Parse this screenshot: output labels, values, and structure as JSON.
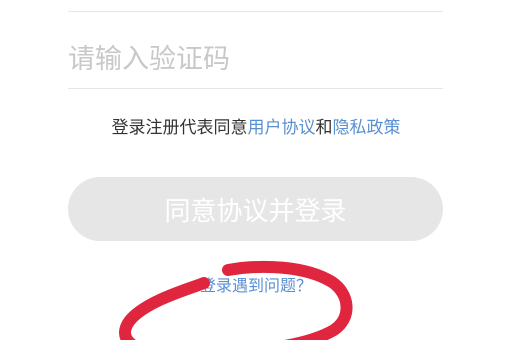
{
  "code_field": {
    "placeholder": "请输入验证码",
    "value": ""
  },
  "agreement": {
    "prefix": "登录注册代表同意",
    "user_agreement_link": "用户协议",
    "conjunction": "和",
    "privacy_policy_link": "隐私政策"
  },
  "agree_button": {
    "label": "同意协议并登录"
  },
  "problem_link": {
    "label": "登录遇到问题？"
  },
  "colors": {
    "link": "#5a8fd0",
    "button_disabled_bg": "#e6e6e6",
    "annotation": "#e0253f"
  }
}
